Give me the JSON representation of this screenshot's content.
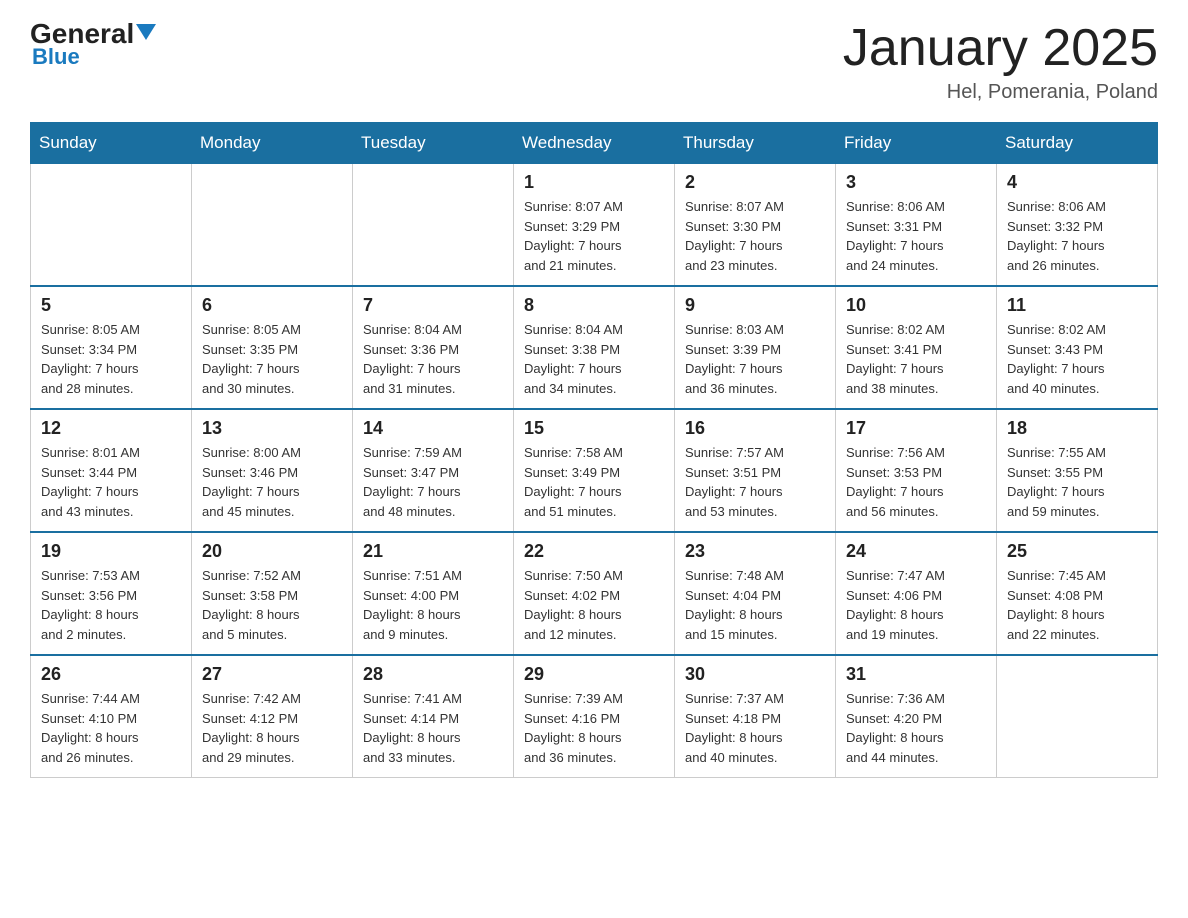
{
  "header": {
    "logo_general": "General",
    "logo_blue": "Blue",
    "month_title": "January 2025",
    "location": "Hel, Pomerania, Poland"
  },
  "days_of_week": [
    "Sunday",
    "Monday",
    "Tuesday",
    "Wednesday",
    "Thursday",
    "Friday",
    "Saturday"
  ],
  "weeks": [
    [
      {
        "day": "",
        "info": ""
      },
      {
        "day": "",
        "info": ""
      },
      {
        "day": "",
        "info": ""
      },
      {
        "day": "1",
        "info": "Sunrise: 8:07 AM\nSunset: 3:29 PM\nDaylight: 7 hours\nand 21 minutes."
      },
      {
        "day": "2",
        "info": "Sunrise: 8:07 AM\nSunset: 3:30 PM\nDaylight: 7 hours\nand 23 minutes."
      },
      {
        "day": "3",
        "info": "Sunrise: 8:06 AM\nSunset: 3:31 PM\nDaylight: 7 hours\nand 24 minutes."
      },
      {
        "day": "4",
        "info": "Sunrise: 8:06 AM\nSunset: 3:32 PM\nDaylight: 7 hours\nand 26 minutes."
      }
    ],
    [
      {
        "day": "5",
        "info": "Sunrise: 8:05 AM\nSunset: 3:34 PM\nDaylight: 7 hours\nand 28 minutes."
      },
      {
        "day": "6",
        "info": "Sunrise: 8:05 AM\nSunset: 3:35 PM\nDaylight: 7 hours\nand 30 minutes."
      },
      {
        "day": "7",
        "info": "Sunrise: 8:04 AM\nSunset: 3:36 PM\nDaylight: 7 hours\nand 31 minutes."
      },
      {
        "day": "8",
        "info": "Sunrise: 8:04 AM\nSunset: 3:38 PM\nDaylight: 7 hours\nand 34 minutes."
      },
      {
        "day": "9",
        "info": "Sunrise: 8:03 AM\nSunset: 3:39 PM\nDaylight: 7 hours\nand 36 minutes."
      },
      {
        "day": "10",
        "info": "Sunrise: 8:02 AM\nSunset: 3:41 PM\nDaylight: 7 hours\nand 38 minutes."
      },
      {
        "day": "11",
        "info": "Sunrise: 8:02 AM\nSunset: 3:43 PM\nDaylight: 7 hours\nand 40 minutes."
      }
    ],
    [
      {
        "day": "12",
        "info": "Sunrise: 8:01 AM\nSunset: 3:44 PM\nDaylight: 7 hours\nand 43 minutes."
      },
      {
        "day": "13",
        "info": "Sunrise: 8:00 AM\nSunset: 3:46 PM\nDaylight: 7 hours\nand 45 minutes."
      },
      {
        "day": "14",
        "info": "Sunrise: 7:59 AM\nSunset: 3:47 PM\nDaylight: 7 hours\nand 48 minutes."
      },
      {
        "day": "15",
        "info": "Sunrise: 7:58 AM\nSunset: 3:49 PM\nDaylight: 7 hours\nand 51 minutes."
      },
      {
        "day": "16",
        "info": "Sunrise: 7:57 AM\nSunset: 3:51 PM\nDaylight: 7 hours\nand 53 minutes."
      },
      {
        "day": "17",
        "info": "Sunrise: 7:56 AM\nSunset: 3:53 PM\nDaylight: 7 hours\nand 56 minutes."
      },
      {
        "day": "18",
        "info": "Sunrise: 7:55 AM\nSunset: 3:55 PM\nDaylight: 7 hours\nand 59 minutes."
      }
    ],
    [
      {
        "day": "19",
        "info": "Sunrise: 7:53 AM\nSunset: 3:56 PM\nDaylight: 8 hours\nand 2 minutes."
      },
      {
        "day": "20",
        "info": "Sunrise: 7:52 AM\nSunset: 3:58 PM\nDaylight: 8 hours\nand 5 minutes."
      },
      {
        "day": "21",
        "info": "Sunrise: 7:51 AM\nSunset: 4:00 PM\nDaylight: 8 hours\nand 9 minutes."
      },
      {
        "day": "22",
        "info": "Sunrise: 7:50 AM\nSunset: 4:02 PM\nDaylight: 8 hours\nand 12 minutes."
      },
      {
        "day": "23",
        "info": "Sunrise: 7:48 AM\nSunset: 4:04 PM\nDaylight: 8 hours\nand 15 minutes."
      },
      {
        "day": "24",
        "info": "Sunrise: 7:47 AM\nSunset: 4:06 PM\nDaylight: 8 hours\nand 19 minutes."
      },
      {
        "day": "25",
        "info": "Sunrise: 7:45 AM\nSunset: 4:08 PM\nDaylight: 8 hours\nand 22 minutes."
      }
    ],
    [
      {
        "day": "26",
        "info": "Sunrise: 7:44 AM\nSunset: 4:10 PM\nDaylight: 8 hours\nand 26 minutes."
      },
      {
        "day": "27",
        "info": "Sunrise: 7:42 AM\nSunset: 4:12 PM\nDaylight: 8 hours\nand 29 minutes."
      },
      {
        "day": "28",
        "info": "Sunrise: 7:41 AM\nSunset: 4:14 PM\nDaylight: 8 hours\nand 33 minutes."
      },
      {
        "day": "29",
        "info": "Sunrise: 7:39 AM\nSunset: 4:16 PM\nDaylight: 8 hours\nand 36 minutes."
      },
      {
        "day": "30",
        "info": "Sunrise: 7:37 AM\nSunset: 4:18 PM\nDaylight: 8 hours\nand 40 minutes."
      },
      {
        "day": "31",
        "info": "Sunrise: 7:36 AM\nSunset: 4:20 PM\nDaylight: 8 hours\nand 44 minutes."
      },
      {
        "day": "",
        "info": ""
      }
    ]
  ]
}
